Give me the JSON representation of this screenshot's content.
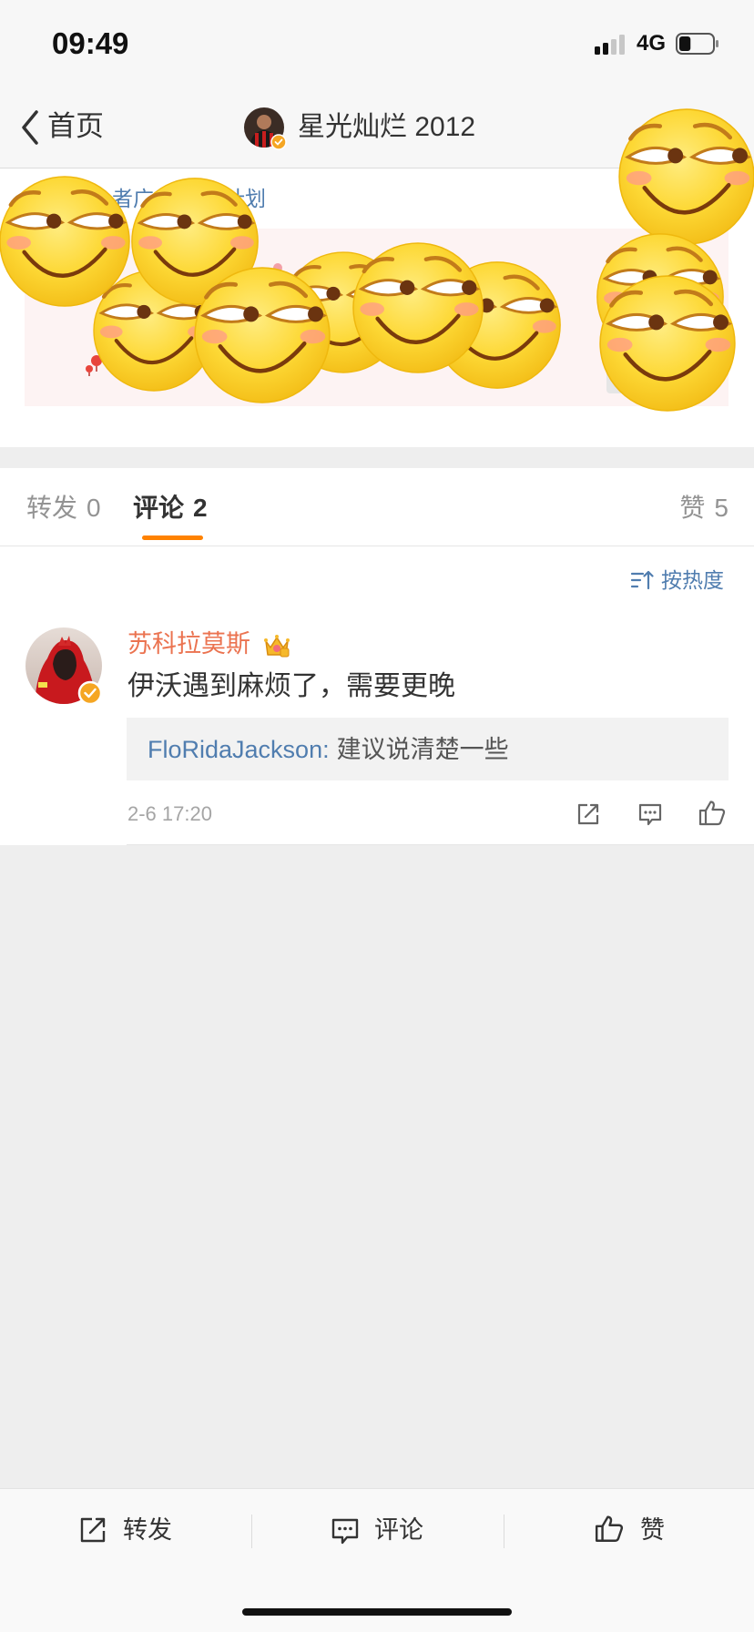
{
  "status_bar": {
    "time": "09:49",
    "network": "4G",
    "battery_level": 0.35
  },
  "nav": {
    "back_label": "首页",
    "title": "星光灿烂 2012"
  },
  "promo": {
    "text_fragments": [
      "者广",
      "计划"
    ]
  },
  "tabs": [
    {
      "label": "转发",
      "count": "0",
      "active": false
    },
    {
      "label": "评论",
      "count": "2",
      "active": true
    },
    {
      "label": "赞",
      "count": "5",
      "active": false
    }
  ],
  "sort": {
    "label": "按热度"
  },
  "comments": [
    {
      "username": "苏科拉莫斯",
      "text": "伊沃遇到麻烦了，需要更晚",
      "reply": {
        "user": "FloRidaJackson",
        "separator": ":",
        "text": "建议说清楚一些"
      },
      "time": "2-6 17:20"
    }
  ],
  "toolbar": {
    "repost": "转发",
    "comment": "评论",
    "like": "赞"
  },
  "colors": {
    "accent": "#ff8200",
    "username": "#eb7350",
    "link": "#507daf",
    "verified_badge": "#f5a623",
    "emoji_yellow": "#fdd835"
  },
  "icons": [
    "signal-icon",
    "battery-icon",
    "chevron-left-icon",
    "verified-badge-icon",
    "sort-icon",
    "crown-icon",
    "share-icon",
    "comment-icon",
    "like-icon",
    "smirk-emoji"
  ]
}
